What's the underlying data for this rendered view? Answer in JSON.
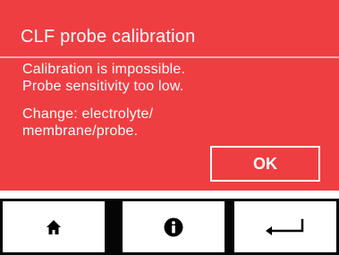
{
  "dialog": {
    "title": "CLF probe calibration",
    "lines": [
      "Calibration is impossible.",
      "Probe sensitivity too low.",
      "Change: electrolyte/",
      "membrane/probe."
    ],
    "ok_label": "OK",
    "background_color": "#ef3e42"
  },
  "toolbar": {
    "buttons": [
      {
        "name": "home",
        "icon": "home-icon"
      },
      {
        "name": "info",
        "icon": "info-icon"
      },
      {
        "name": "back",
        "icon": "return-arrow-icon"
      }
    ]
  }
}
